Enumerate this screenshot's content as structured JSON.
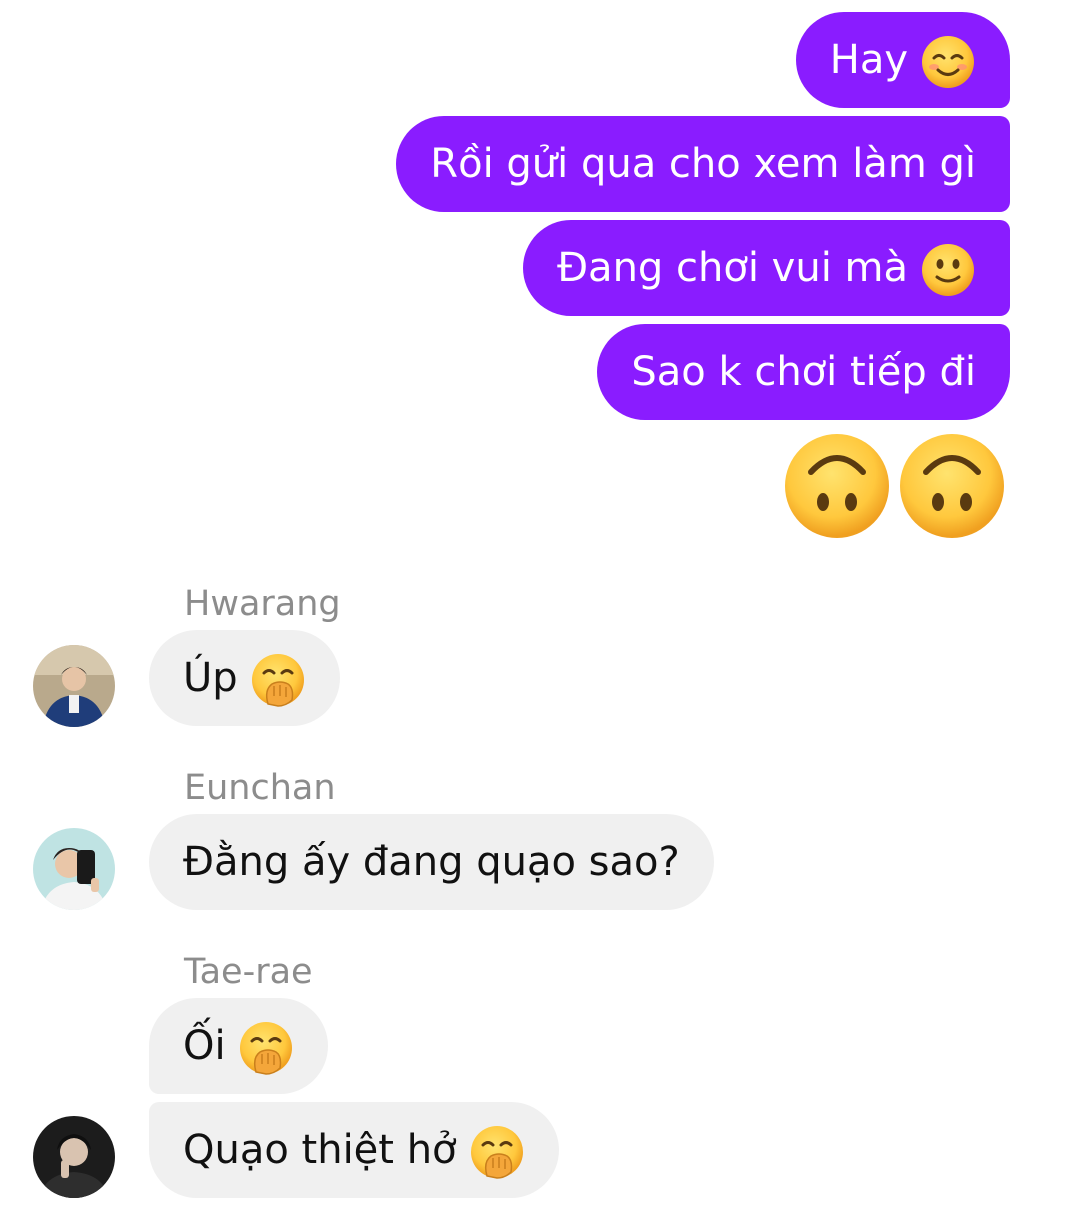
{
  "messages_out": [
    {
      "text": "Hay",
      "emoji": "smiling-face-icon"
    },
    {
      "text": "Rồi gửi qua cho xem làm gì"
    },
    {
      "text": "Đang chơi vui mà",
      "emoji": "slightly-smiling-face-icon"
    },
    {
      "text": "Sao k chơi tiếp đi"
    }
  ],
  "reaction_emojis": [
    "upside-down-face-icon",
    "upside-down-face-icon"
  ],
  "messages_in": [
    {
      "sender": "Hwarang",
      "text": "Úp",
      "emoji": "hand-over-mouth-icon"
    },
    {
      "sender": "Eunchan",
      "text": "Đằng ấy đang quạo sao?"
    },
    {
      "sender": "Tae-rae",
      "text": "Ối",
      "emoji": "hand-over-mouth-icon"
    },
    {
      "text": "Quạo thiệt hở",
      "emoji": "hand-over-mouth-icon"
    }
  ],
  "colors": {
    "outgoing_bubble": "#8a1cff",
    "incoming_bubble": "#f0f0f0",
    "sender_name": "#8c8c8c"
  }
}
